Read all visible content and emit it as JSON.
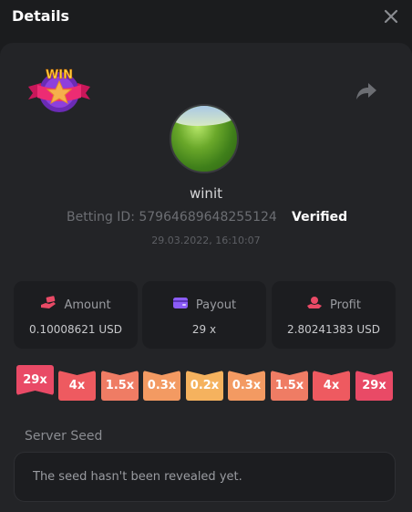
{
  "header": {
    "title": "Details"
  },
  "badge": {
    "text": "WIN"
  },
  "player": {
    "username": "winit",
    "betting_id": "Betting ID: 57964689648255124",
    "verified": "Verified",
    "timestamp": "29.03.2022, 16:10:07"
  },
  "stats": {
    "amount": {
      "label": "Amount",
      "value": "0.10008621 USD",
      "icon": "money-hand-icon"
    },
    "payout": {
      "label": "Payout",
      "value": "29 x",
      "icon": "wallet-icon"
    },
    "profit": {
      "label": "Profit",
      "value": "2.80241383 USD",
      "icon": "coin-hand-icon"
    }
  },
  "multipliers": [
    {
      "label": "29x",
      "color": "#e94a66",
      "hit": true
    },
    {
      "label": "4x",
      "color": "#ee5a60",
      "hit": false
    },
    {
      "label": "1.5x",
      "color": "#ef7c64",
      "hit": false
    },
    {
      "label": "0.3x",
      "color": "#f39a62",
      "hit": false
    },
    {
      "label": "0.2x",
      "color": "#f5b25e",
      "hit": false
    },
    {
      "label": "0.3x",
      "color": "#f39a62",
      "hit": false
    },
    {
      "label": "1.5x",
      "color": "#ef7c64",
      "hit": false
    },
    {
      "label": "4x",
      "color": "#ee5a60",
      "hit": false
    },
    {
      "label": "29x",
      "color": "#e94a66",
      "hit": false
    }
  ],
  "server_seed": {
    "label": "Server Seed",
    "text": "The seed hasn't been revealed yet."
  },
  "colors": {
    "background": "#1b1c1e",
    "card": "#232427",
    "stat_box": "#1c1d20",
    "amount_icon": "#e94a66",
    "payout_icon": "#8b5cf6",
    "profit_icon": "#e94a66"
  }
}
